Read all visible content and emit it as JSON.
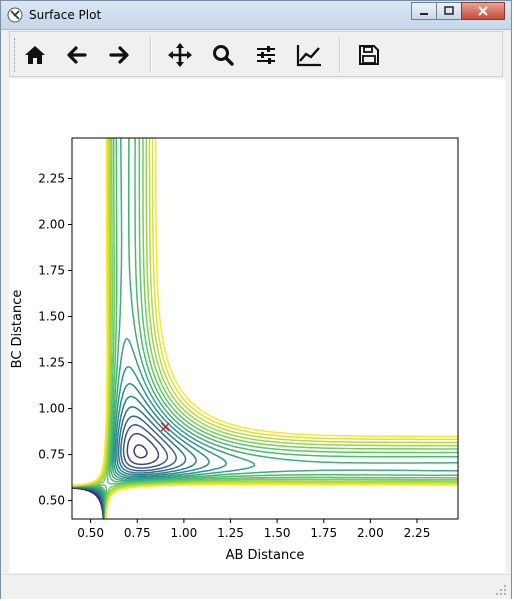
{
  "window": {
    "title": "Surface Plot"
  },
  "toolbar": {
    "buttons": [
      {
        "name": "home-button",
        "icon": "home-icon"
      },
      {
        "name": "back-button",
        "icon": "arrow-left-icon"
      },
      {
        "name": "forward-button",
        "icon": "arrow-right-icon"
      },
      {
        "name": "pan-button",
        "icon": "move-icon"
      },
      {
        "name": "zoom-button",
        "icon": "magnifier-icon"
      },
      {
        "name": "configure-subplots-button",
        "icon": "sliders-icon"
      },
      {
        "name": "edit-axis-button",
        "icon": "line-chart-icon"
      },
      {
        "name": "save-button",
        "icon": "floppy-disk-icon"
      }
    ]
  },
  "chart_data": {
    "type": "contour",
    "xlabel": "AB Distance",
    "ylabel": "BC Distance",
    "xlim": [
      0.4,
      2.47
    ],
    "ylim": [
      0.4,
      2.47
    ],
    "xticks": [
      "0.50",
      "0.75",
      "1.00",
      "1.25",
      "1.50",
      "1.75",
      "2.00",
      "2.25"
    ],
    "yticks": [
      "0.50",
      "0.75",
      "1.00",
      "1.25",
      "1.50",
      "1.75",
      "2.00",
      "2.25"
    ],
    "colormap": "viridis",
    "marker": {
      "symbol": "x",
      "color": "#d62728",
      "x": 0.9,
      "y": 0.9
    },
    "level_count": 20
  }
}
